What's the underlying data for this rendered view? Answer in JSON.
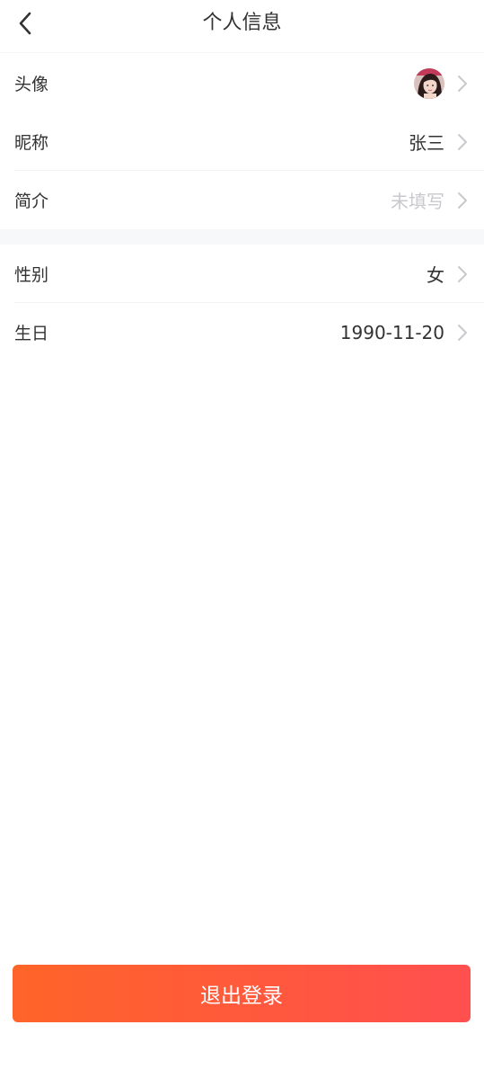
{
  "header": {
    "title": "个人信息",
    "back_icon": "chevron-left-icon"
  },
  "profile": {
    "avatar": {
      "label": "头像"
    },
    "nickname": {
      "label": "昵称",
      "value": "张三"
    },
    "intro": {
      "label": "简介",
      "placeholder": "未填写"
    }
  },
  "details": {
    "gender": {
      "label": "性别",
      "value": "女"
    },
    "birthday": {
      "label": "生日",
      "value": "1990-11-20"
    }
  },
  "actions": {
    "logout_label": "退出登录"
  },
  "colors": {
    "primary_gradient_start": "#ff6428",
    "primary_gradient_end": "#ff4f4f",
    "text": "#323233",
    "placeholder": "#c8c9cc",
    "chevron": "#c8c9cc",
    "section_gap": "#f7f8fa"
  }
}
